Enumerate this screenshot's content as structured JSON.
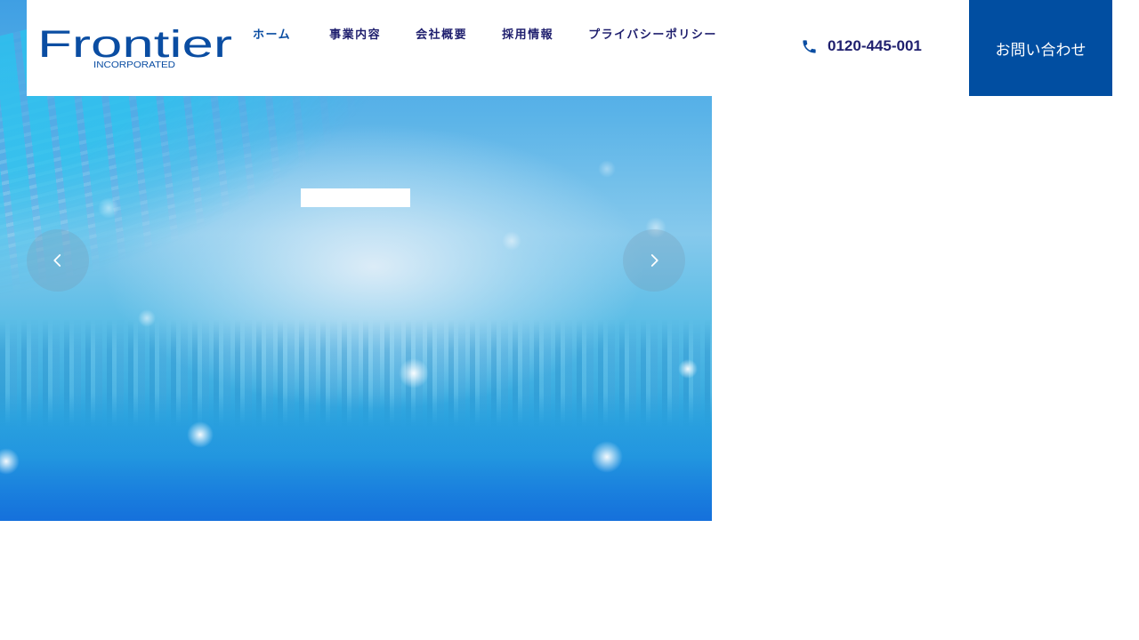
{
  "brand": {
    "name": "Frontier",
    "tagline": "INCORPORATED",
    "color": "#0a4da2"
  },
  "nav": {
    "items": [
      {
        "label": "ホーム",
        "active": true
      },
      {
        "label": "事業内容",
        "active": false
      },
      {
        "label": "会社概要",
        "active": false
      },
      {
        "label": "採用情報",
        "active": false
      },
      {
        "label": "プライバシーポリシー",
        "active": false
      }
    ]
  },
  "header": {
    "phone": "0120-445-001",
    "contact_label": "お問い合わせ",
    "phone_icon": "phone-icon",
    "contact_color": "#014ea1"
  },
  "slider": {
    "prev_icon": "chevron-left-icon",
    "next_icon": "chevron-right-icon"
  }
}
